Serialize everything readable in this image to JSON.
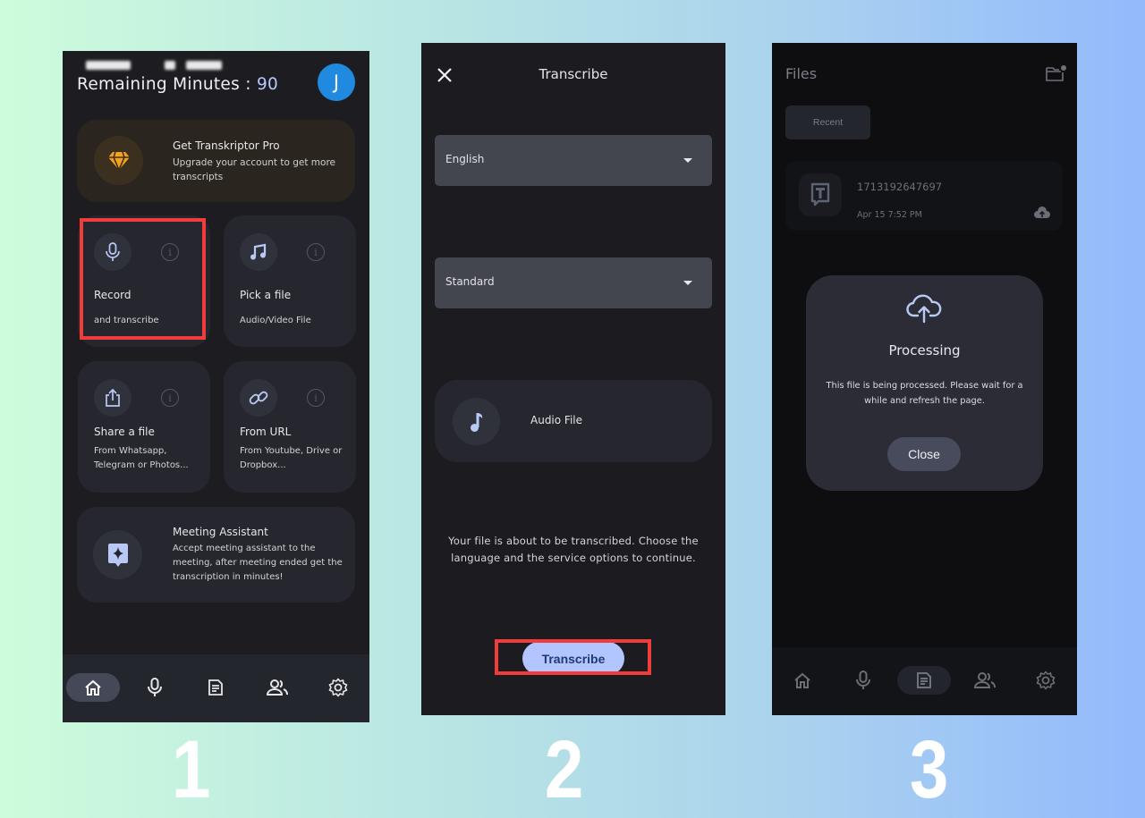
{
  "step_numbers": [
    "1",
    "2",
    "3"
  ],
  "screen1": {
    "remaining_label": "Remaining Minutes : ",
    "remaining_value": "90",
    "avatar_initial": "J",
    "pro_card": {
      "title": "Get Transkriptor Pro",
      "description": "Upgrade your account to get more transcripts",
      "icon": "diamond-icon"
    },
    "tiles": [
      {
        "title": "Record",
        "subtitle": "and transcribe",
        "icon": "microphone-icon",
        "highlighted": true
      },
      {
        "title": "Pick a file",
        "subtitle": "Audio/Video File",
        "icon": "music-note-icon"
      },
      {
        "title": "Share a file",
        "subtitle": "From Whatsapp, Telegram or Photos...",
        "icon": "share-icon"
      },
      {
        "title": "From URL",
        "subtitle": "From Youtube, Drive or Dropbox...",
        "icon": "link-icon"
      }
    ],
    "meeting_card": {
      "title": "Meeting Assistant",
      "description": "Accept meeting assistant to the meeting, after meeting ended get the transcription in minutes!",
      "icon": "sparkle-chat-icon"
    },
    "nav": [
      {
        "name": "home",
        "icon": "home-icon",
        "active": true
      },
      {
        "name": "record",
        "icon": "microphone-icon"
      },
      {
        "name": "files",
        "icon": "document-icon"
      },
      {
        "name": "team",
        "icon": "people-icon"
      },
      {
        "name": "settings",
        "icon": "gear-icon"
      }
    ]
  },
  "screen2": {
    "title": "Transcribe",
    "language_select": {
      "value": "English"
    },
    "service_select": {
      "value": "Standard"
    },
    "audio_card_label": "Audio File",
    "message": "Your file is about to be transcribed. Choose the language and the service options to continue.",
    "transcribe_button": "Transcribe"
  },
  "screen3": {
    "title": "Files",
    "recent_chip": "Recent",
    "file": {
      "name": "1713192647697",
      "date": "Apr 15 7:52 PM"
    },
    "modal": {
      "title": "Processing",
      "message": "This file is being processed. Please wait for a while and refresh the page.",
      "close_button": "Close"
    },
    "nav_active": "files"
  },
  "colors": {
    "accent": "#b3c5ff",
    "highlight_red": "#f23c3c",
    "avatar_blue": "#1f8ae0",
    "pro_orange": "#f7a21b"
  }
}
